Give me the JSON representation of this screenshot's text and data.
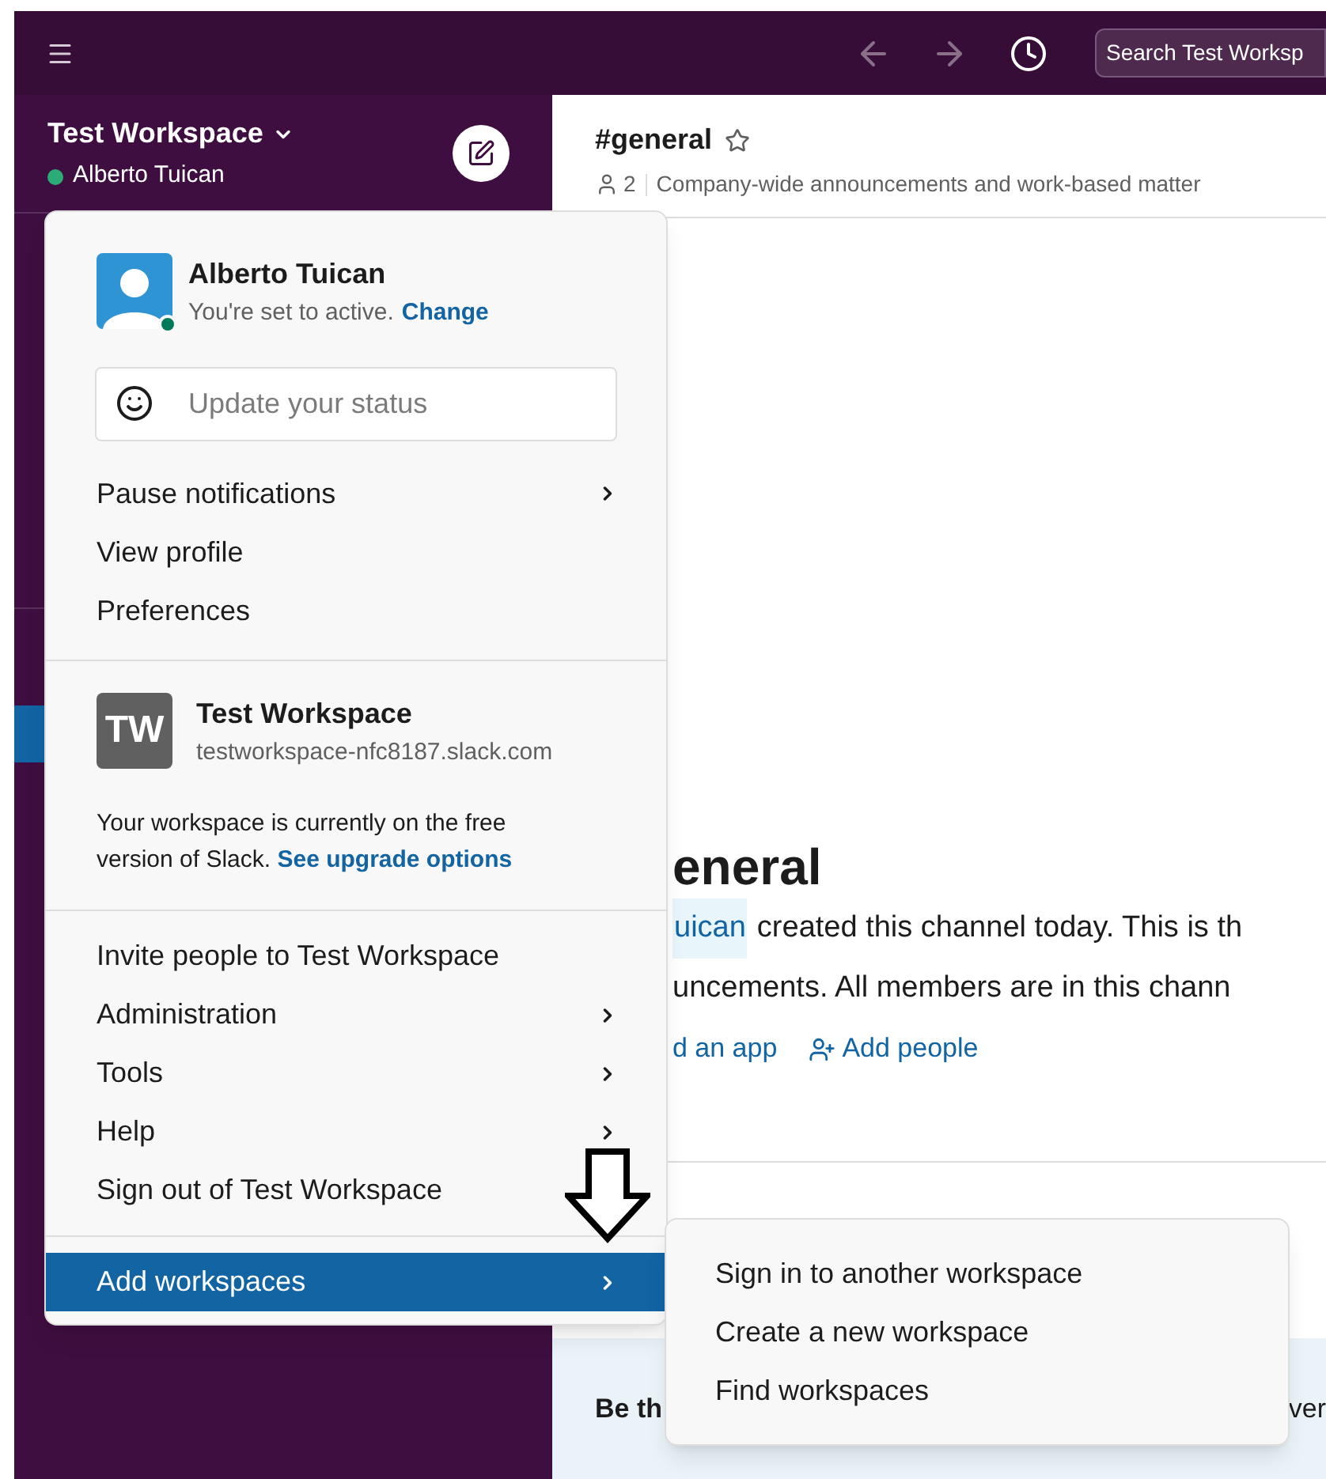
{
  "topbar": {
    "search": {
      "placeholder": "Search Test Worksp"
    }
  },
  "sidebar": {
    "workspace_name": "Test Workspace",
    "user": "Alberto Tuican"
  },
  "channel": {
    "name": "#general",
    "members": "2",
    "topic": "Company-wide announcements and work-based matter"
  },
  "intro": {
    "heading": "eneral",
    "mention": "uican",
    "line_1": "created this channel today. This is th",
    "line_2": "uncements. All members are in this chann",
    "actions": [
      {
        "kind": "app",
        "label": "d an app"
      },
      {
        "kind": "people",
        "label": "Add people"
      }
    ]
  },
  "banner": {
    "left": "Be th",
    "right": "ver"
  },
  "menu": {
    "user": {
      "name": "Alberto Tuican",
      "status": "You're set to active.",
      "change_link": "Change"
    },
    "status_field": {
      "placeholder": "Update your status"
    },
    "profile_items": [
      {
        "label": "Pause notifications",
        "has_submenu": true,
        "selected": false
      },
      {
        "label": "View profile",
        "has_submenu": false,
        "selected": false
      },
      {
        "label": "Preferences",
        "has_submenu": false,
        "selected": false
      }
    ],
    "workspace": {
      "initials": "TW",
      "name": "Test Workspace",
      "url": "testworkspace-nfc8187.slack.com",
      "note": "Your workspace is currently on the free version of Slack.",
      "link": "See upgrade options"
    },
    "workspace_items": [
      {
        "label": "Invite people to Test Workspace",
        "has_submenu": false,
        "selected": false
      },
      {
        "label": "Administration",
        "has_submenu": true,
        "selected": false
      },
      {
        "label": "Tools",
        "has_submenu": true,
        "selected": false
      },
      {
        "label": "Help",
        "has_submenu": true,
        "selected": false
      },
      {
        "label": "Sign out of Test Workspace",
        "has_submenu": false,
        "selected": false
      }
    ],
    "bottom_items": [
      {
        "label": "Add workspaces",
        "has_submenu": true,
        "selected": true
      }
    ]
  },
  "submenu": {
    "items": [
      "Sign in to another workspace",
      "Create a new workspace",
      "Find workspaces"
    ]
  }
}
